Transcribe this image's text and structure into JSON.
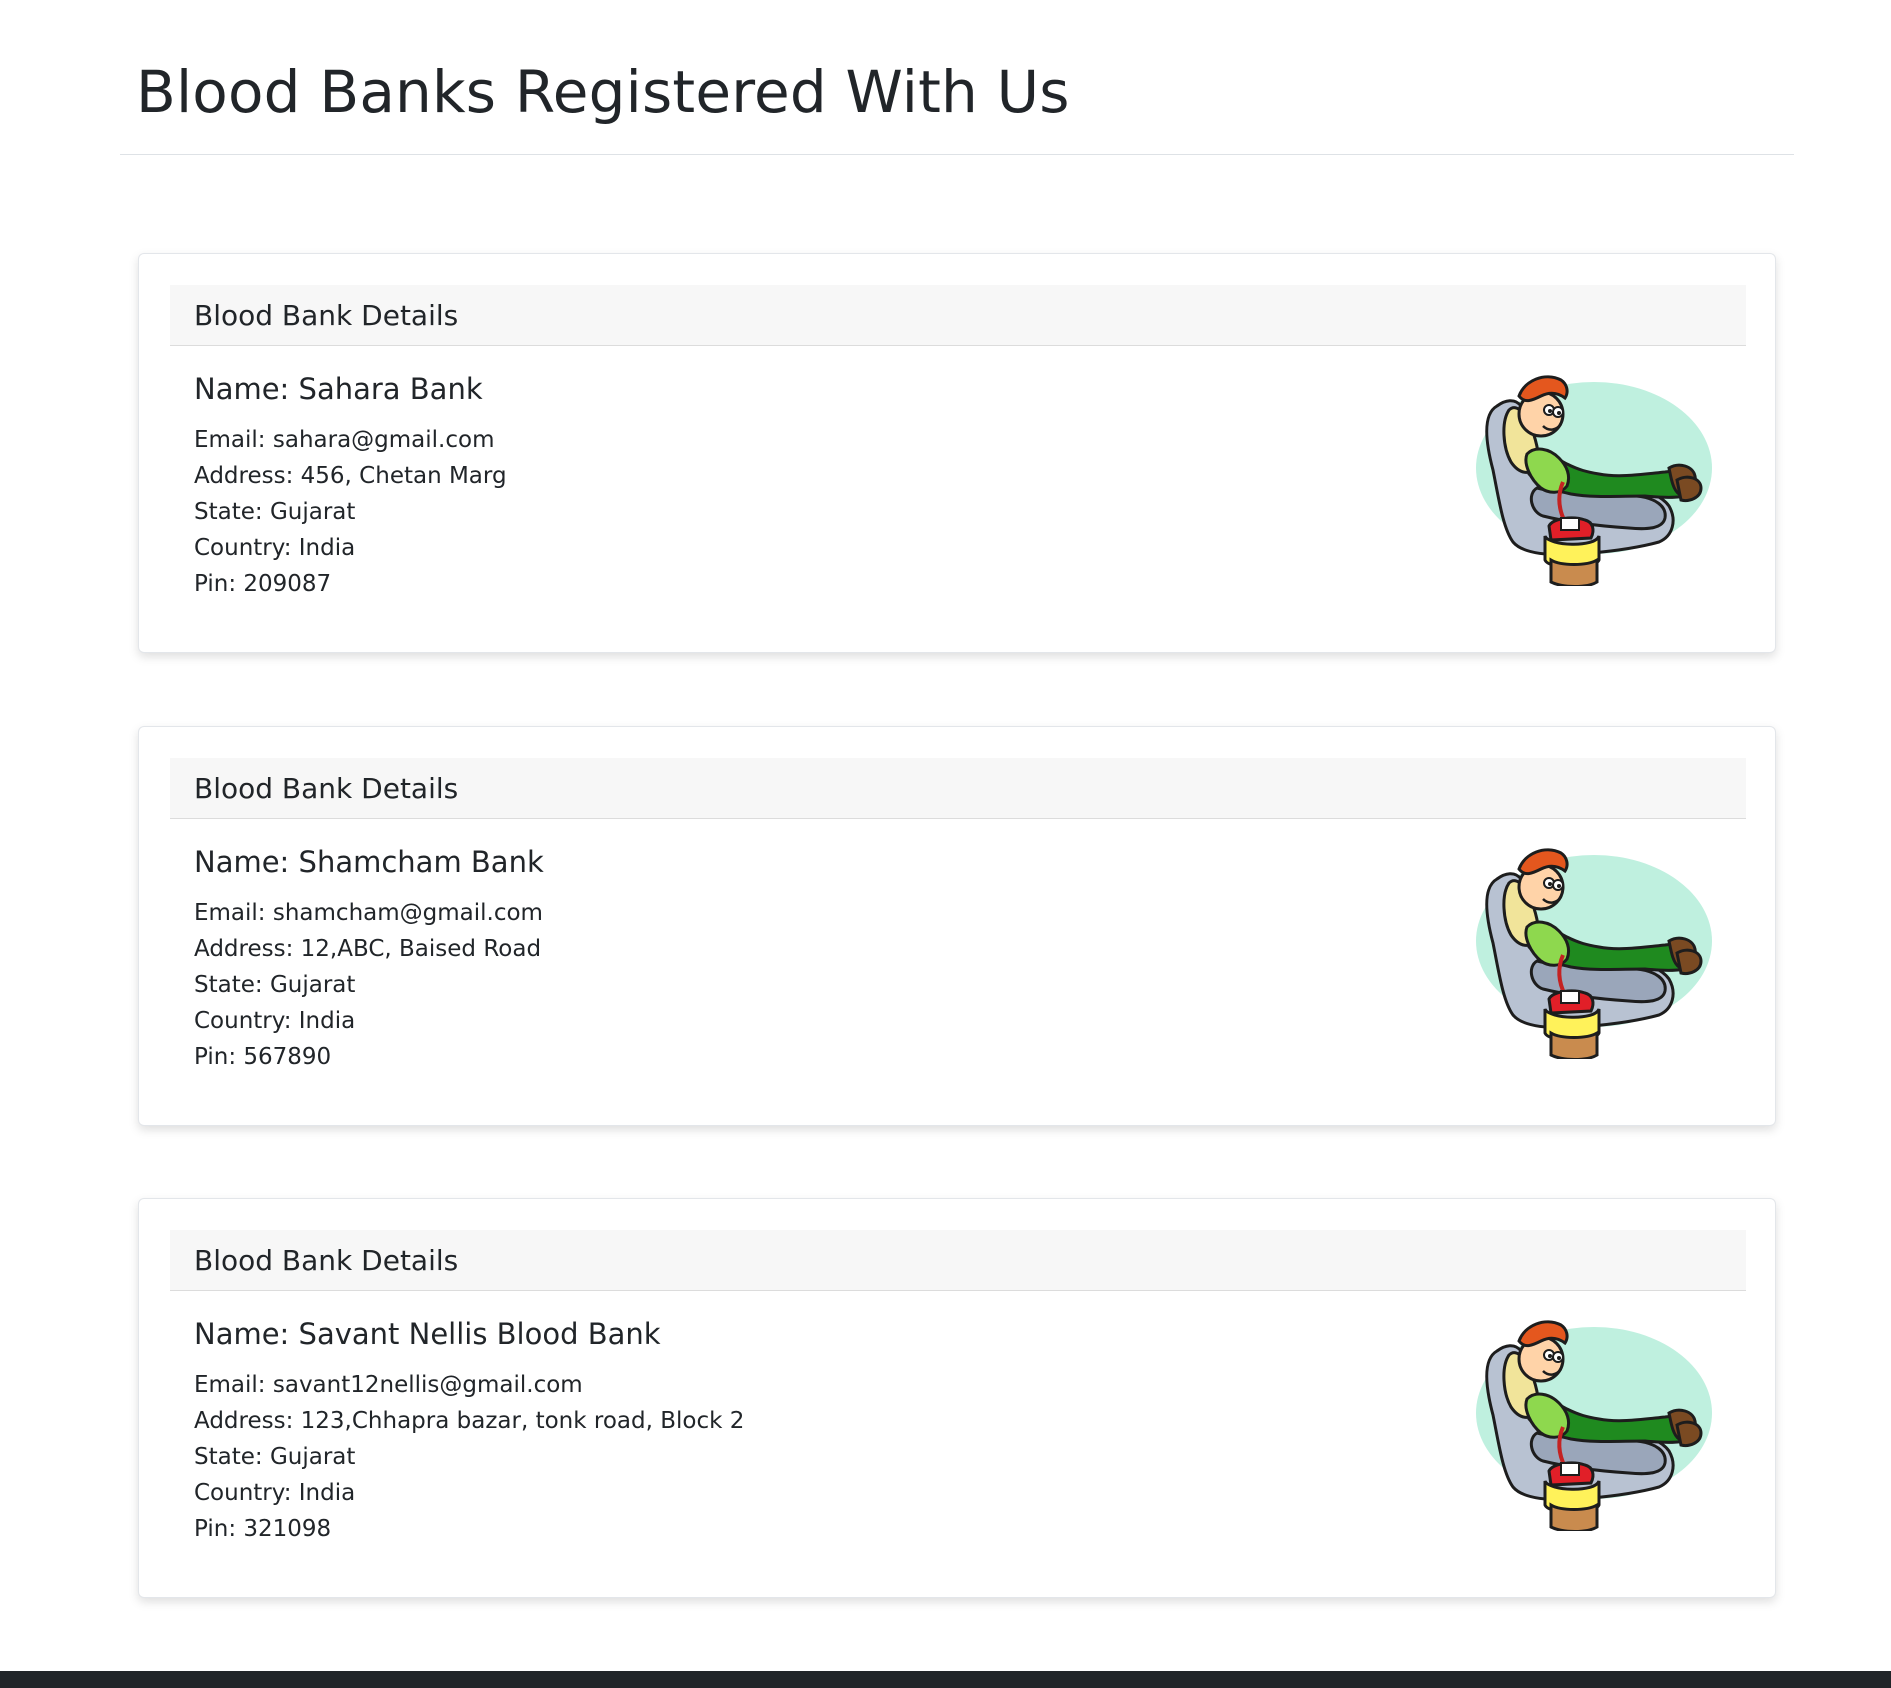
{
  "page": {
    "title": "Blood Banks Registered With Us"
  },
  "cards": [
    {
      "header": "Blood Bank Details",
      "name": "Name: Sahara Bank",
      "email": "Email: sahara@gmail.com",
      "address": "Address: 456, Chetan Marg",
      "state": "State: Gujarat",
      "country": "Country: India",
      "pin": "Pin: 209087",
      "image_icon": "blood-donor-illustration-icon"
    },
    {
      "header": "Blood Bank Details",
      "name": "Name: Shamcham Bank",
      "email": "Email: shamcham@gmail.com",
      "address": "Address: 12,ABC, Baised Road",
      "state": "State: Gujarat",
      "country": "Country: India",
      "pin": "Pin: 567890",
      "image_icon": "blood-donor-illustration-icon"
    },
    {
      "header": "Blood Bank Details",
      "name": "Name: Savant Nellis Blood Bank",
      "email": "Email: savant12nellis@gmail.com",
      "address": "Address: 123,Chhapra bazar, tonk road, Block 2",
      "state": "State: Gujarat",
      "country": "Country: India",
      "pin": "Pin: 321098",
      "image_icon": "blood-donor-illustration-icon"
    }
  ],
  "colors": {
    "text": "#212529",
    "card_header_bg": "#f7f7f7",
    "footer_bar": "#212529"
  }
}
